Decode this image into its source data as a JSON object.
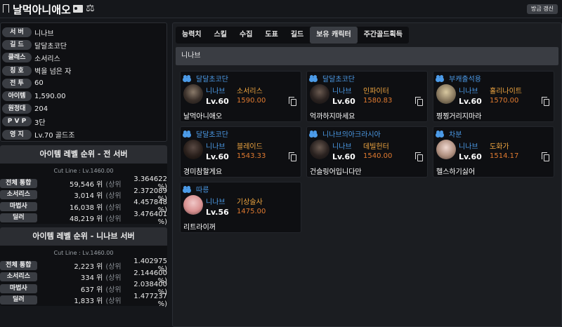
{
  "header": {
    "title": "날먹아니애오",
    "refresh_label": "방금 갱신"
  },
  "info": [
    {
      "label": "서 버",
      "value": "니나브"
    },
    {
      "label": "길 드",
      "value": "달달초코단"
    },
    {
      "label": "클래스",
      "value": "소서리스"
    },
    {
      "label": "칭 호",
      "value": "벽을 넘은 자"
    },
    {
      "label": "전 투",
      "value": "60"
    },
    {
      "label": "아이템",
      "value": "1,590.00"
    },
    {
      "label": "원정대",
      "value": "204"
    },
    {
      "label": "P V P",
      "value": "3단"
    },
    {
      "label": "영 지",
      "value": "Lv.70 골드조"
    }
  ],
  "rank_all": {
    "title": "아이템 레벨 순위 - 전 서버",
    "cutline": "Cut Line : Lv.1460.00",
    "rows": [
      {
        "label": "전체 통합",
        "rank": "59,546 위",
        "top": "(상위",
        "pct": "3.364622 %)"
      },
      {
        "label": "소서리스",
        "rank": "3,014 위",
        "top": "(상위",
        "pct": "2.372089 %)"
      },
      {
        "label": "마법사",
        "rank": "16,038 위",
        "top": "(상위",
        "pct": "4.457848 %)"
      },
      {
        "label": "딜러",
        "rank": "48,219 위",
        "top": "(상위",
        "pct": "3.476401 %)"
      }
    ]
  },
  "rank_server": {
    "title": "아이템 레벨 순위 - 니나브 서버",
    "cutline": "Cut Line : Lv.1460.00",
    "rows": [
      {
        "label": "전체 통합",
        "rank": "2,223 위",
        "top": "(상위",
        "pct": "1.402975 %)"
      },
      {
        "label": "소서리스",
        "rank": "334 위",
        "top": "(상위",
        "pct": "2.144600 %)"
      },
      {
        "label": "마법사",
        "rank": "637 위",
        "top": "(상위",
        "pct": "2.038400 %)"
      },
      {
        "label": "딜러",
        "rank": "1,833 위",
        "top": "(상위",
        "pct": "1.477237 %)"
      }
    ]
  },
  "tabs": [
    "능력치",
    "스킬",
    "수집",
    "도표",
    "길드",
    "보유 캐릭터",
    "주간골드획득"
  ],
  "active_tab": "보유 캐릭터",
  "server_bar": "니나브",
  "characters": [
    {
      "guild": "달달초코단",
      "server": "니나브",
      "class": "소서리스",
      "level": "Lv.60",
      "ilvl": "1590.00",
      "name": "날먹아니애오"
    },
    {
      "guild": "달달초코단",
      "server": "니나브",
      "class": "인파이터",
      "level": "Lv.60",
      "ilvl": "1580.83",
      "name": "억까하지마세요"
    },
    {
      "guild": "부캐출석용",
      "server": "니나브",
      "class": "홀리나이트",
      "level": "Lv.60",
      "ilvl": "1570.00",
      "name": "찡찡거리지마라"
    },
    {
      "guild": "달달초코단",
      "server": "니나브",
      "class": "블레이드",
      "level": "Lv.60",
      "ilvl": "1543.33",
      "name": "경미참할게요"
    },
    {
      "guild": "니나브의아크라시아",
      "server": "니나브",
      "class": "데빌헌터",
      "level": "Lv.60",
      "ilvl": "1540.00",
      "name": "건슬링어입니다만"
    },
    {
      "guild": "차분",
      "server": "니나브",
      "class": "도화가",
      "level": "Lv.60",
      "ilvl": "1514.17",
      "name": "헬스하기싫어"
    },
    {
      "guild": "따릉",
      "server": "니나브",
      "class": "기상술사",
      "level": "Lv.56",
      "ilvl": "1475.00",
      "name": "리트라이꺼"
    }
  ],
  "colors": {
    "guild": "#4c9be8",
    "class": "#f0a640",
    "ilvl": "#e07a30",
    "background": "#15171b"
  }
}
